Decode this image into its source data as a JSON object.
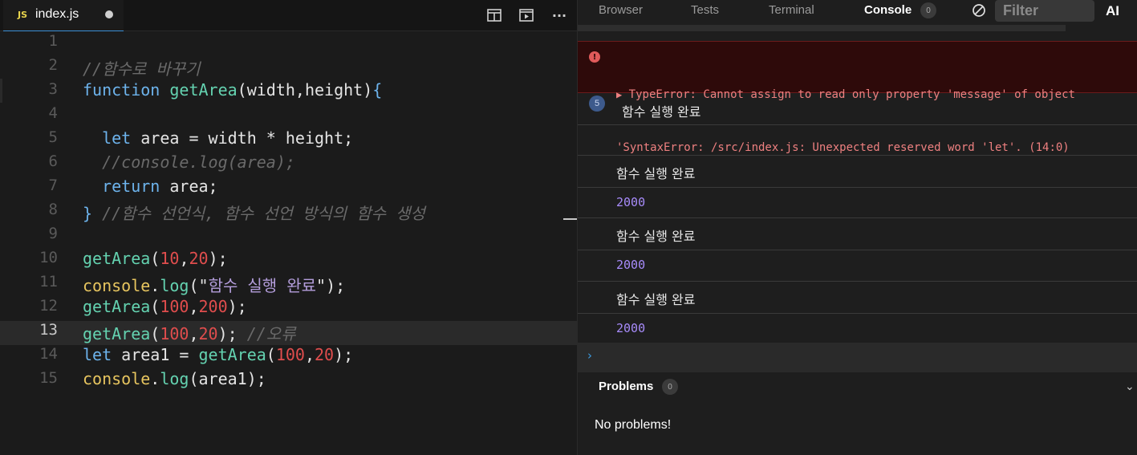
{
  "editor": {
    "tab": {
      "icon": "JS",
      "label": "index.js"
    },
    "toolbar": {
      "more_label": "···"
    },
    "lines": [
      {
        "n": "1",
        "tokens": []
      },
      {
        "n": "2",
        "tokens": [
          {
            "t": "//함수로 바꾸기",
            "c": "cm"
          }
        ]
      },
      {
        "n": "3",
        "tokens": [
          {
            "t": "function ",
            "c": "kw"
          },
          {
            "t": "getArea",
            "c": "fn"
          },
          {
            "t": "(width,height)",
            "c": "tx"
          },
          {
            "t": "{",
            "c": "kw"
          }
        ]
      },
      {
        "n": "4",
        "tokens": []
      },
      {
        "n": "5",
        "tokens": [
          {
            "t": "  let ",
            "c": "kw"
          },
          {
            "t": "area = width * height;",
            "c": "tx"
          }
        ]
      },
      {
        "n": "6",
        "tokens": [
          {
            "t": "  //console.log(area);",
            "c": "cm"
          }
        ]
      },
      {
        "n": "7",
        "tokens": [
          {
            "t": "  return ",
            "c": "kw"
          },
          {
            "t": "area;",
            "c": "tx"
          }
        ]
      },
      {
        "n": "8",
        "tokens": [
          {
            "t": "} ",
            "c": "kw"
          },
          {
            "t": "//함수 선언식, 함수 선언 방식의 함수 생성",
            "c": "cm"
          }
        ]
      },
      {
        "n": "9",
        "tokens": []
      },
      {
        "n": "10",
        "tokens": [
          {
            "t": "getArea",
            "c": "fn"
          },
          {
            "t": "(",
            "c": "tx"
          },
          {
            "t": "10",
            "c": "num"
          },
          {
            "t": ",",
            "c": "tx"
          },
          {
            "t": "20",
            "c": "num"
          },
          {
            "t": ");",
            "c": "tx"
          }
        ]
      },
      {
        "n": "11",
        "tokens": [
          {
            "t": "console",
            "c": "ob"
          },
          {
            "t": ".",
            "c": "tx"
          },
          {
            "t": "log",
            "c": "fn"
          },
          {
            "t": "(\"",
            "c": "tx"
          },
          {
            "t": "함수 실행 완료",
            "c": "str"
          },
          {
            "t": "\");",
            "c": "tx"
          }
        ]
      },
      {
        "n": "12",
        "tokens": [
          {
            "t": "getArea",
            "c": "fn"
          },
          {
            "t": "(",
            "c": "tx"
          },
          {
            "t": "100",
            "c": "num"
          },
          {
            "t": ",",
            "c": "tx"
          },
          {
            "t": "200",
            "c": "num"
          },
          {
            "t": ");",
            "c": "tx"
          }
        ]
      },
      {
        "n": "13",
        "active": true,
        "tokens": [
          {
            "t": "getArea",
            "c": "fn"
          },
          {
            "t": "(",
            "c": "tx"
          },
          {
            "t": "100",
            "c": "num"
          },
          {
            "t": ",",
            "c": "tx"
          },
          {
            "t": "20",
            "c": "num"
          },
          {
            "t": "); ",
            "c": "tx"
          },
          {
            "t": "//오류",
            "c": "cm"
          }
        ]
      },
      {
        "n": "14",
        "tokens": [
          {
            "t": "let ",
            "c": "kw"
          },
          {
            "t": "area1 = ",
            "c": "tx"
          },
          {
            "t": "getArea",
            "c": "fn"
          },
          {
            "t": "(",
            "c": "tx"
          },
          {
            "t": "100",
            "c": "num"
          },
          {
            "t": ",",
            "c": "tx"
          },
          {
            "t": "20",
            "c": "num"
          },
          {
            "t": ");",
            "c": "tx"
          }
        ]
      },
      {
        "n": "15",
        "tokens": [
          {
            "t": "console",
            "c": "ob"
          },
          {
            "t": ".",
            "c": "tx"
          },
          {
            "t": "log",
            "c": "fn"
          },
          {
            "t": "(area1);",
            "c": "tx"
          }
        ]
      }
    ]
  },
  "panel": {
    "tabs": [
      {
        "label": "Browser"
      },
      {
        "label": "Tests"
      },
      {
        "label": "Terminal"
      },
      {
        "label": "Console",
        "active": true,
        "badge": "0"
      }
    ],
    "filter_placeholder": "Filter",
    "ai_label": "AI",
    "console": {
      "error": {
        "line1": "TypeError: Cannot assign to read only property 'message' of object",
        "line2": "'SyntaxError: /src/index.js: Unexpected reserved word 'let'. (14:0)"
      },
      "grouped": {
        "count": "5",
        "text": "함수 실행 완료"
      },
      "entries": [
        {
          "text": ""
        },
        {
          "text": "함수 실행 완료"
        },
        {
          "text": "2000",
          "number": true
        },
        {
          "text": "함수 실행 완료"
        },
        {
          "text": "2000",
          "number": true
        },
        {
          "text": "함수 실행 완료"
        },
        {
          "text": "2000",
          "number": true
        }
      ]
    },
    "problems": {
      "title": "Problems",
      "badge": "0",
      "empty_text": "No problems!"
    }
  }
}
